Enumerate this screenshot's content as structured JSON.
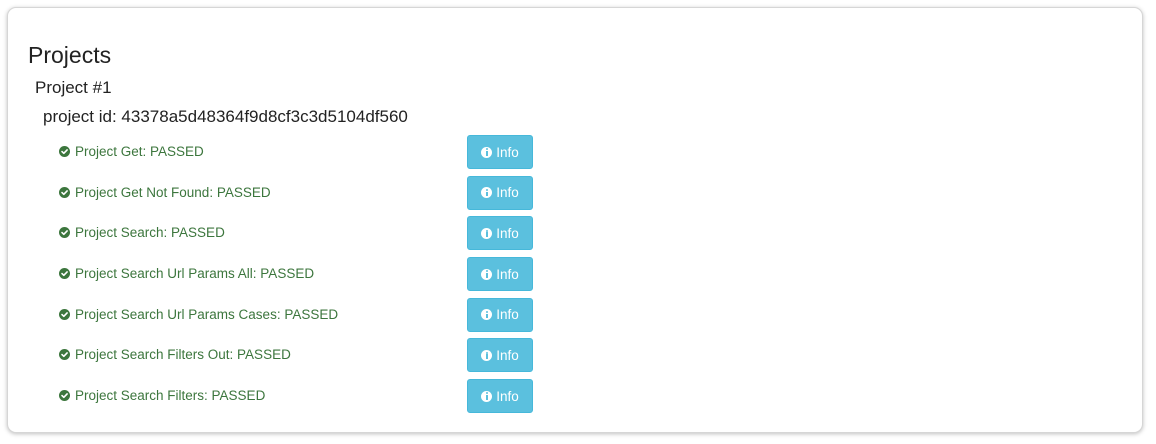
{
  "page": {
    "title": "Projects"
  },
  "project": {
    "name": "Project #1",
    "id_text": "project id: 43378a5d48364f9d8cf3c3d5104df560"
  },
  "tests": [
    {
      "label": "Project Get: PASSED",
      "button": "Info",
      "status": "passed"
    },
    {
      "label": "Project Get Not Found: PASSED",
      "button": "Info",
      "status": "passed"
    },
    {
      "label": "Project Search: PASSED",
      "button": "Info",
      "status": "passed"
    },
    {
      "label": "Project Search Url Params All: PASSED",
      "button": "Info",
      "status": "passed"
    },
    {
      "label": "Project Search Url Params Cases: PASSED",
      "button": "Info",
      "status": "passed"
    },
    {
      "label": "Project Search Filters Out: PASSED",
      "button": "Info",
      "status": "passed"
    },
    {
      "label": "Project Search Filters: PASSED",
      "button": "Info",
      "status": "passed"
    }
  ],
  "icons": {
    "status": "check-circle-icon",
    "button": "info-circle-icon"
  },
  "colors": {
    "passed_text": "#3c763d",
    "info_button": "#5bc0de",
    "info_button_border": "#46b8da"
  }
}
